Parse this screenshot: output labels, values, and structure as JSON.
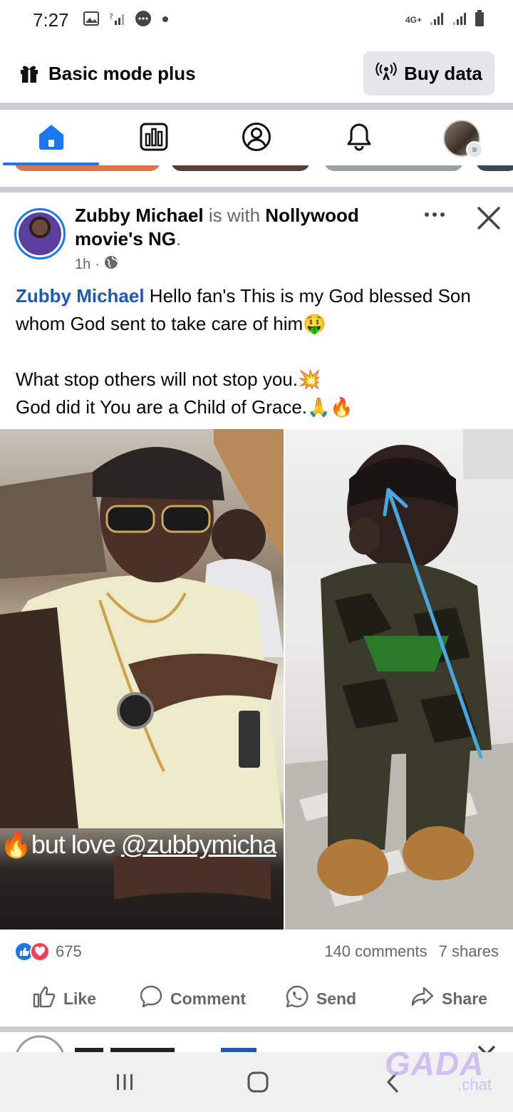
{
  "status_bar": {
    "time": "7:27",
    "network": "4G+",
    "icons": [
      "image-icon",
      "signal-unknown-icon",
      "chat-bubble-icon",
      "dot-icon",
      "signal-bars-icon",
      "signal-bars-icon",
      "battery-icon"
    ]
  },
  "header": {
    "mode_label": "Basic mode plus",
    "buy_data_label": "Buy data",
    "icons": [
      "gift-icon",
      "broadcast-icon"
    ]
  },
  "nav": {
    "tabs": [
      {
        "name": "home",
        "icon": "home-icon",
        "active": true
      },
      {
        "name": "dashboard",
        "icon": "bar-chart-icon",
        "active": false
      },
      {
        "name": "profile",
        "icon": "user-circle-icon",
        "active": false
      },
      {
        "name": "notifications",
        "icon": "bell-icon",
        "active": false
      },
      {
        "name": "menu",
        "icon": "avatar-menu-icon",
        "active": false
      }
    ],
    "accent": "#1877f2"
  },
  "post": {
    "author": "Zubby Michael",
    "with_text": "is with",
    "tagged": "Nollywood movie's NG",
    "period": ".",
    "time": "1h",
    "separator": "·",
    "body_author": "Zubby Michael",
    "body_line1": " Hello fan's This is my God blessed Son whom God sent to take care of him🤑",
    "body_line2": "What stop others will not stop you.💥",
    "body_line3": "God did it You are a Child of Grace.🙏🔥",
    "photo_caption_prefix": "🔥but love ",
    "photo_caption_handle": "@zubbymicha",
    "reactions_count": "675",
    "comments": "140 comments",
    "shares": "7 shares",
    "actions": {
      "like": "Like",
      "comment": "Comment",
      "send": "Send",
      "share": "Share"
    }
  },
  "watermark": {
    "main": "GADA",
    "sub": ".chat"
  },
  "colors": {
    "brand_blue": "#1877f2",
    "author_blue": "#1a5bb5",
    "muted": "#65676b",
    "love_red": "#f33e58"
  }
}
